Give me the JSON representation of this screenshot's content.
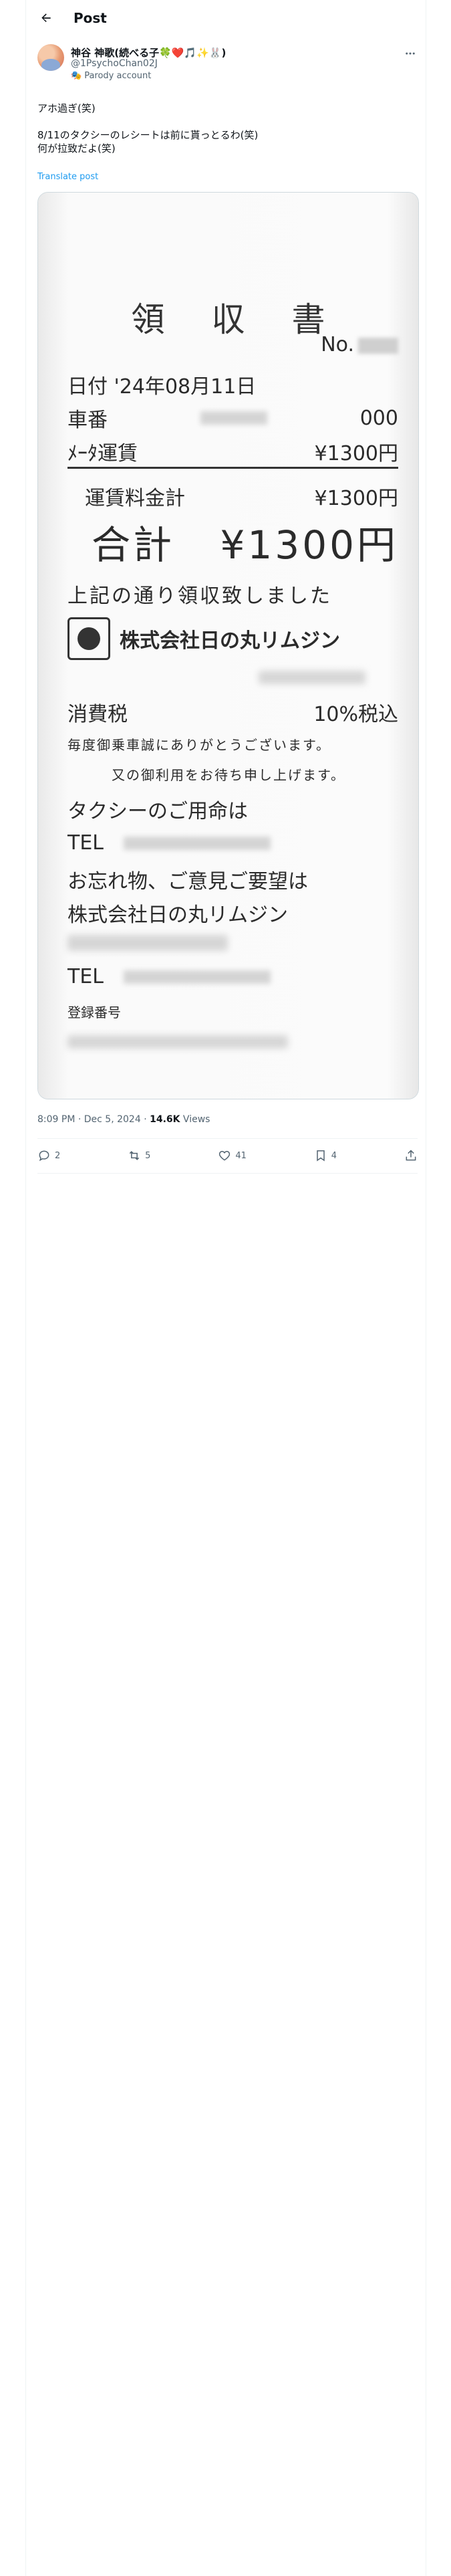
{
  "header": {
    "title": "Post"
  },
  "author": {
    "name": "神谷 神歌(続べる子🍀❤️🎵✨🐰)",
    "handle": "@1PsychoChan02J",
    "label": "Parody account"
  },
  "post": {
    "line1": "アホ過ぎ(笑)",
    "line2": "8/11のタクシーのレシートは前に貰っとるわ(笑)",
    "line3": "何が拉致だよ(笑)",
    "translate": "Translate post"
  },
  "receipt": {
    "title": "領収書",
    "no_label": "No.",
    "date": "日付 '24年08月11日",
    "car_label": "車番",
    "car_suffix": "000",
    "meter_label": "ﾒｰﾀ運賃",
    "meter_value": "¥1300円",
    "fare_label": "運賃料金計",
    "fare_value": "¥1300円",
    "total_label": "合計",
    "total_value": "¥1300円",
    "received": "上記の通り領収致しました",
    "company": "株式会社日の丸リムジン",
    "tax_label": "消費税",
    "tax_value": "10%税込",
    "thanks1": "毎度御乗車誠にありがとうございます。",
    "thanks2": "又の御利用をお待ち申し上げます。",
    "taxi_call": "タクシーのご用命は",
    "tel1": "TEL",
    "lost": "お忘れ物、ご意見ご要望は",
    "company2": "株式会社日の丸リムジン",
    "tel2": "TEL",
    "reg": "登録番号"
  },
  "meta": {
    "time": "8:09 PM · Dec 5, 2024 · ",
    "views": "14.6K",
    "views_label": " Views"
  },
  "actions": {
    "replies": "2",
    "reposts": "5",
    "likes": "41",
    "bookmarks": "4"
  }
}
